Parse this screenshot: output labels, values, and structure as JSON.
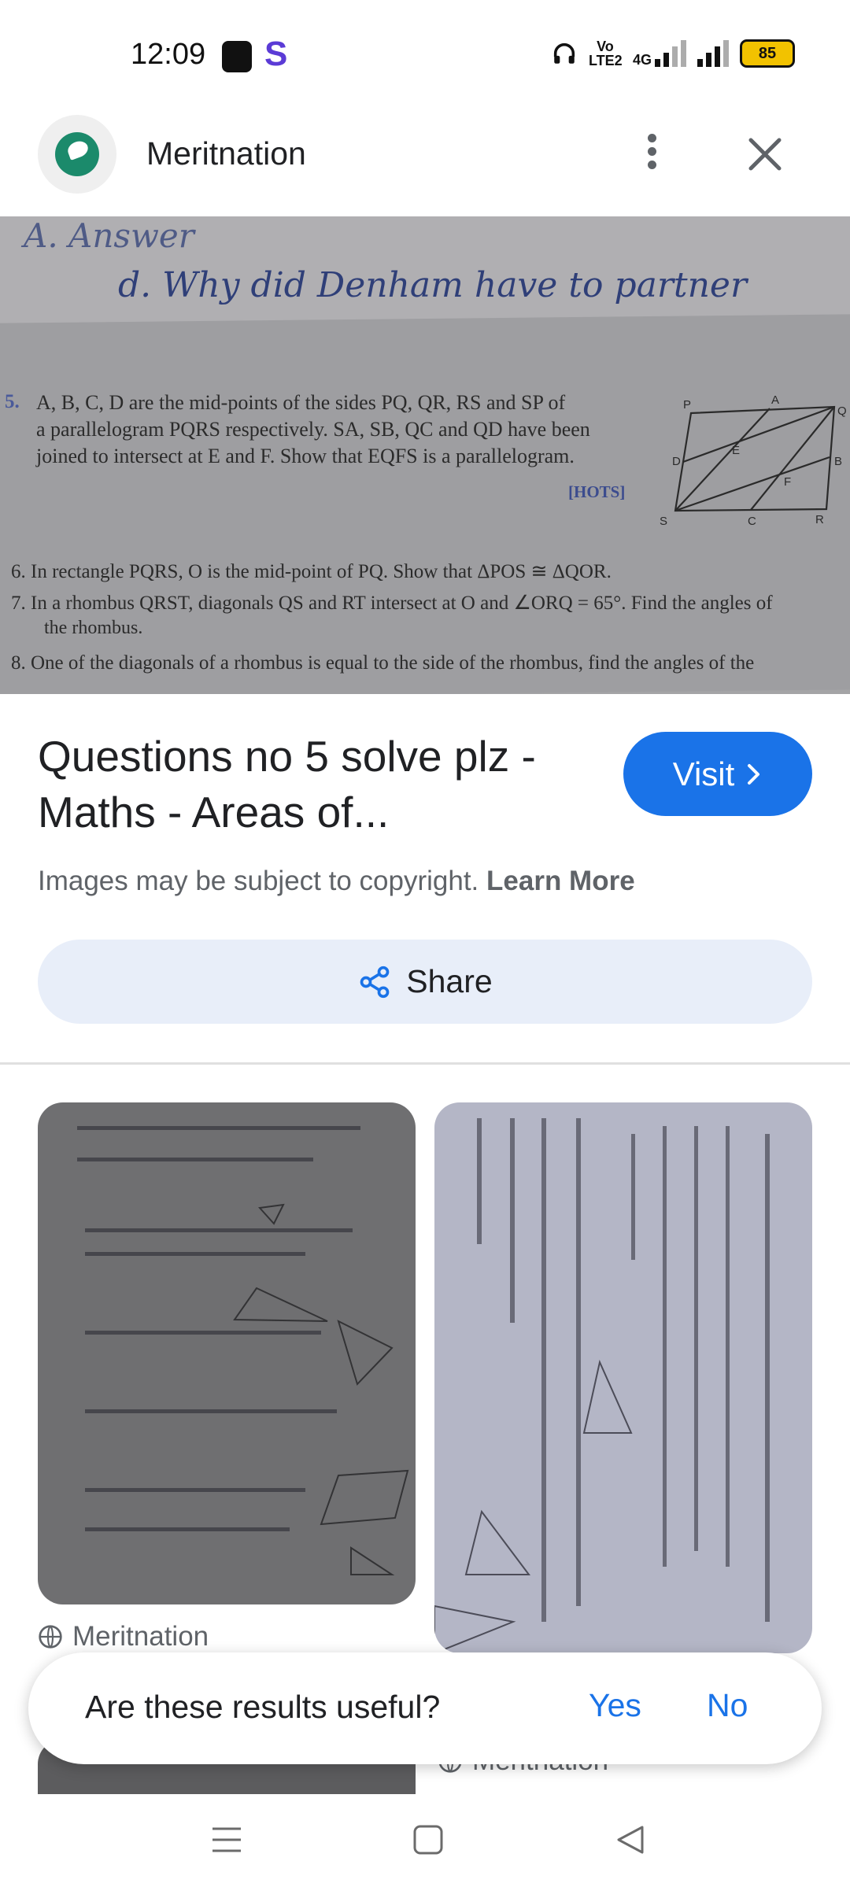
{
  "status_bar": {
    "time": "12:09",
    "network_volte": "Vo LTE2",
    "network_type": "4G",
    "battery": "85"
  },
  "header": {
    "site_name": "Meritnation"
  },
  "main_image": {
    "handwriting_line1": "A. Answer",
    "handwriting_line2": "d. Why did Denham have to partner",
    "question_5_number": "5.",
    "question_5_line1": "A, B, C, D are the mid-points of the sides PQ, QR, RS and SP of",
    "question_5_line2": "a parallelogram PQRS respectively. SA, SB, QC and QD have been",
    "question_5_line3": "joined to intersect at E and F. Show that EQFS is a parallelogram.",
    "hots": "[HOTS]",
    "question_6": "6.  In rectangle PQRS, O is the mid-point of PQ. Show that ΔPOS ≅ ΔQOR.",
    "question_7_line1": "7.  In a rhombus QRST, diagonals QS and RT intersect at O and ∠ORQ = 65°. Find the angles of",
    "question_7_line2": "the rhombus.",
    "question_8": "8.  One of the diagonals of a rhombus is equal to the side of the rhombus, find the angles of the",
    "figure_labels": {
      "P": "P",
      "A": "A",
      "Q": "Q",
      "E": "E",
      "D": "D",
      "B": "B",
      "F": "F",
      "S": "S",
      "C": "C",
      "R": "R"
    }
  },
  "result": {
    "title": "Questions no 5 solve plz - Maths - Areas of...",
    "visit_label": "Visit",
    "copyright_text": "Images may be subject to copyright.",
    "learn_more": "Learn More",
    "share_label": "Share"
  },
  "related": {
    "source_1": "Meritnation",
    "source_2": "Meritnation"
  },
  "feedback": {
    "question": "Are these results useful?",
    "yes": "Yes",
    "no": "No"
  },
  "icons": {
    "calendar": "calendar-icon",
    "s_app": "s-app-icon",
    "headphones": "headphones-icon",
    "signal": "signal-icon",
    "battery": "battery-icon",
    "menu": "more-vert-icon",
    "close": "close-icon",
    "chevron": "chevron-right-icon",
    "share": "share-icon",
    "globe": "globe-icon",
    "nav_menu": "menu-icon",
    "nav_home": "home-icon",
    "nav_back": "back-icon"
  },
  "colors": {
    "accent": "#1a73e8",
    "share_bg": "#e8eef9",
    "logo_green": "#1b8a6b",
    "battery": "#f2c200"
  }
}
